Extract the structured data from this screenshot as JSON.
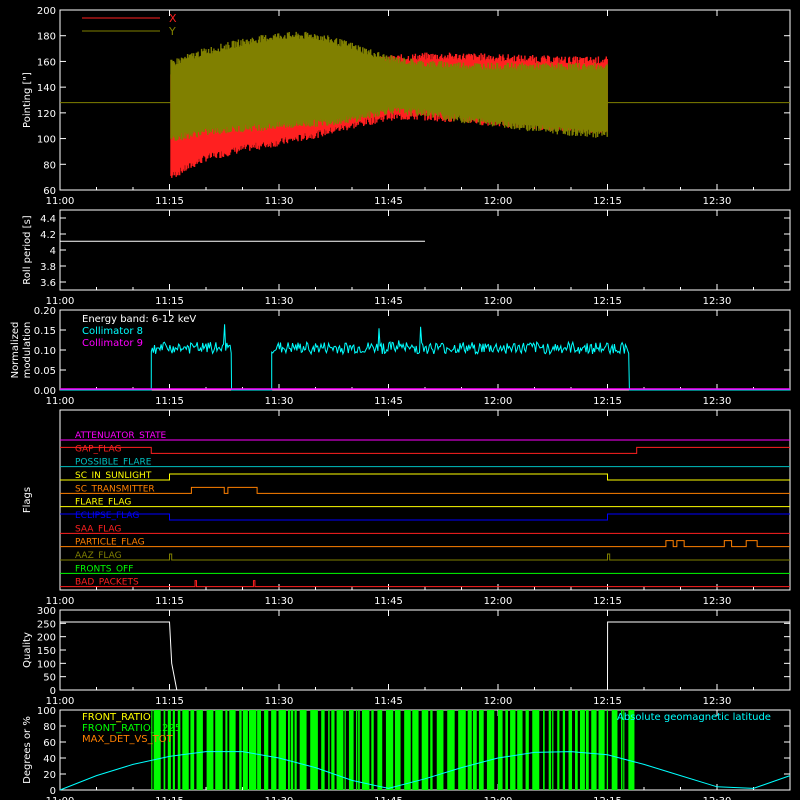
{
  "colors": {
    "background": "#000000",
    "axes": "#ffffff",
    "x": "#ff2020",
    "y": "#808000",
    "cyan": "#00ffff",
    "magenta": "#ff00ff",
    "green": "#00ff00",
    "yellow": "#ffff00",
    "orange": "#ff8000",
    "red": "#ff2020",
    "blue": "#0000ff",
    "teal": "#00c0c0"
  },
  "time_axis": {
    "ticks": [
      "11:00",
      "11:15",
      "11:30",
      "11:45",
      "12:00",
      "12:15",
      "12:30"
    ],
    "range_min": [
      0,
      50
    ]
  },
  "chart_data": [
    {
      "type": "line",
      "ylabel": "Pointing [\"]",
      "ylim": [
        60,
        200
      ],
      "yticks": [
        60,
        80,
        100,
        120,
        140,
        160,
        180,
        200
      ],
      "legend": {
        "placement": "top-left",
        "entries": [
          {
            "name": "X",
            "color": "#ff2020"
          },
          {
            "name": "Y",
            "color": "#808000"
          }
        ]
      },
      "series": [
        {
          "name": "X",
          "color": "#ff2020",
          "x_min": [
            15,
            20,
            25,
            30,
            35,
            40,
            45,
            50,
            55,
            60,
            65,
            70,
            75
          ],
          "upper": [
            150,
            150,
            150,
            150,
            152,
            157,
            162,
            164,
            164,
            163,
            162,
            161,
            161
          ],
          "lower": [
            70,
            85,
            92,
            97,
            103,
            110,
            117,
            117,
            115,
            112,
            110,
            108,
            107
          ]
        },
        {
          "name": "Y",
          "color": "#808000",
          "x_min": [
            15,
            20,
            25,
            30,
            35,
            40,
            45,
            50,
            55,
            60,
            65,
            70,
            75
          ],
          "upper": [
            158,
            168,
            175,
            180,
            180,
            172,
            162,
            158,
            157,
            156,
            156,
            156,
            156
          ],
          "lower": [
            100,
            105,
            108,
            110,
            112,
            115,
            122,
            120,
            115,
            112,
            108,
            105,
            103
          ]
        }
      ],
      "reference_line": {
        "y": 128,
        "color": "#808000"
      }
    },
    {
      "type": "line",
      "ylabel": "Roll period [s]",
      "ylim": [
        3.5,
        4.5
      ],
      "yticks": [
        3.6,
        3.8,
        4.0,
        4.2,
        4.4
      ],
      "series": [
        {
          "name": "",
          "color": "#ffffff",
          "x_min": [
            0,
            50
          ],
          "y": [
            4.11,
            4.11
          ]
        }
      ]
    },
    {
      "type": "line",
      "ylabel": "Normalized modulation",
      "ylim": [
        0,
        0.2
      ],
      "yticks": [
        "0.00",
        "0.05",
        "0.10",
        "0.15",
        "0.20"
      ],
      "legend": {
        "placement": "top-left",
        "title": "Energy band: 6-12 keV",
        "entries": [
          {
            "name": "Collimator 8",
            "color": "#00ffff"
          },
          {
            "name": "Collimator 9",
            "color": "#ff00ff"
          }
        ]
      },
      "series": [
        {
          "name": "Collimator 8",
          "color": "#00ffff",
          "segments": [
            {
              "from": 12.5,
              "to": 23.5,
              "mean": 0.105,
              "spread": 0.015
            },
            {
              "from": 29,
              "to": 78,
              "mean": 0.105,
              "spread": 0.015
            }
          ]
        },
        {
          "name": "Collimator 9",
          "color": "#ff00ff",
          "value": 0
        }
      ]
    },
    {
      "type": "line",
      "ylabel": "Flags",
      "flags": [
        {
          "name": "ATTENUATOR_STATE",
          "color": "#ff00ff",
          "steps": [
            [
              0,
              0
            ]
          ]
        },
        {
          "name": "GAP_FLAG",
          "color": "#ff2020",
          "steps": [
            [
              0,
              1
            ],
            [
              12.5,
              0
            ],
            [
              79,
              1
            ]
          ]
        },
        {
          "name": "POSSIBLE_FLARE",
          "color": "#00c0c0",
          "steps": [
            [
              0,
              0
            ]
          ]
        },
        {
          "name": "SC_IN_SUNLIGHT",
          "color": "#ffff00",
          "steps": [
            [
              0,
              0
            ],
            [
              15,
              1
            ],
            [
              75,
              0
            ]
          ]
        },
        {
          "name": "SC_TRANSMITTER",
          "color": "#ff8000",
          "steps": [
            [
              0,
              0
            ],
            [
              18,
              1
            ],
            [
              22.5,
              0
            ],
            [
              23,
              1
            ],
            [
              27,
              0
            ]
          ]
        },
        {
          "name": "FLARE_FLAG",
          "color": "#ffff00",
          "steps": [
            [
              0,
              0
            ]
          ]
        },
        {
          "name": "ECLIPSE_FLAG",
          "color": "#0000ff",
          "steps": [
            [
              0,
              1
            ],
            [
              15,
              0
            ],
            [
              75,
              1
            ]
          ]
        },
        {
          "name": "SAA_FLAG",
          "color": "#ff2020",
          "steps": [
            [
              0,
              0
            ]
          ]
        },
        {
          "name": "PARTICLE_FLAG",
          "color": "#ff8000",
          "steps": [
            [
              0,
              0
            ],
            [
              83,
              1
            ],
            [
              84,
              0
            ],
            [
              84.5,
              1
            ],
            [
              85.5,
              0
            ],
            [
              91,
              1
            ],
            [
              92,
              0
            ],
            [
              94,
              1
            ],
            [
              95.5,
              0
            ]
          ]
        },
        {
          "name": "AAZ_FLAG",
          "color": "#808000",
          "steps": [
            [
              0,
              0
            ],
            [
              15,
              1
            ],
            [
              15.3,
              0
            ],
            [
              75,
              1
            ],
            [
              75.3,
              0
            ]
          ]
        },
        {
          "name": "FRONTS_OFF",
          "color": "#00ff00",
          "steps": [
            [
              0,
              0
            ]
          ]
        },
        {
          "name": "BAD_PACKETS",
          "color": "#ff2020",
          "steps": [
            [
              0,
              0
            ],
            [
              18.5,
              1
            ],
            [
              18.7,
              0
            ],
            [
              26.5,
              1
            ],
            [
              26.7,
              0
            ]
          ]
        }
      ]
    },
    {
      "type": "line",
      "ylabel": "Quality",
      "ylim": [
        0,
        300
      ],
      "yticks": [
        0,
        50,
        100,
        150,
        200,
        250,
        300
      ],
      "series": [
        {
          "name": "",
          "color": "#ffffff",
          "x_min": [
            0,
            15,
            15.3,
            16,
            75,
            75.01,
            100
          ],
          "y": [
            255,
            255,
            100,
            0,
            0,
            255,
            255
          ]
        }
      ]
    },
    {
      "type": "area",
      "ylabel": "Degrees or %",
      "ylim": [
        0,
        100
      ],
      "yticks": [
        0,
        20,
        40,
        60,
        80,
        100
      ],
      "legend": {
        "placement": "top-left",
        "entries": [
          {
            "name": "FRONT_RATIO",
            "color": "#ffff00"
          },
          {
            "name": "FRONT_RATIO_1225",
            "color": "#00ff00"
          },
          {
            "name": "MAX_DET_VS_TOT",
            "color": "#ff8000"
          }
        ]
      },
      "secondary_label": {
        "name": "Absolute geomagnetic latitude",
        "color": "#00ffff"
      },
      "series": [
        {
          "name": "FRONT_RATIO_1225",
          "color": "#00ff00",
          "from": 12.5,
          "to": 78,
          "value": 100
        },
        {
          "name": "Absolute geomagnetic latitude",
          "color": "#00ffff",
          "x_min": [
            0,
            5,
            10,
            15,
            20,
            25,
            30,
            35,
            40,
            45,
            50,
            55,
            60,
            65,
            70,
            75,
            80,
            85,
            90,
            95,
            100
          ],
          "y": [
            0,
            18,
            32,
            42,
            48,
            48,
            40,
            28,
            12,
            2,
            14,
            28,
            40,
            47,
            48,
            44,
            32,
            18,
            4,
            2,
            18
          ]
        }
      ]
    }
  ]
}
